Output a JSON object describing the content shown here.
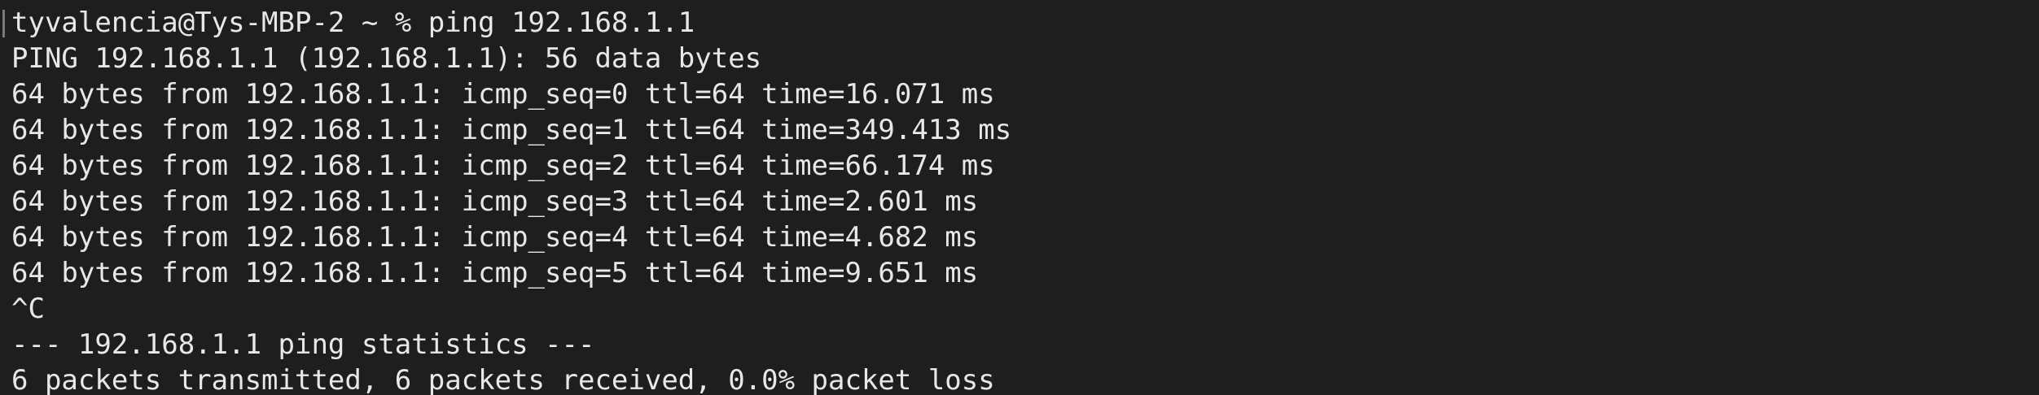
{
  "terminal": {
    "prompt_line": "tyvalencia@Tys-MBP-2 ~ % ping 192.168.1.1",
    "header_line": "PING 192.168.1.1 (192.168.1.1): 56 data bytes",
    "replies": [
      "64 bytes from 192.168.1.1: icmp_seq=0 ttl=64 time=16.071 ms",
      "64 bytes from 192.168.1.1: icmp_seq=1 ttl=64 time=349.413 ms",
      "64 bytes from 192.168.1.1: icmp_seq=2 ttl=64 time=66.174 ms",
      "64 bytes from 192.168.1.1: icmp_seq=3 ttl=64 time=2.601 ms",
      "64 bytes from 192.168.1.1: icmp_seq=4 ttl=64 time=4.682 ms",
      "64 bytes from 192.168.1.1: icmp_seq=5 ttl=64 time=9.651 ms"
    ],
    "interrupt_line": "^C",
    "stats_header_line": "--- 192.168.1.1 ping statistics ---",
    "stats_summary_line": "6 packets transmitted, 6 packets received, 0.0% packet loss"
  },
  "colors": {
    "background": "#1e1e1e",
    "text": "#e8e8e8"
  }
}
